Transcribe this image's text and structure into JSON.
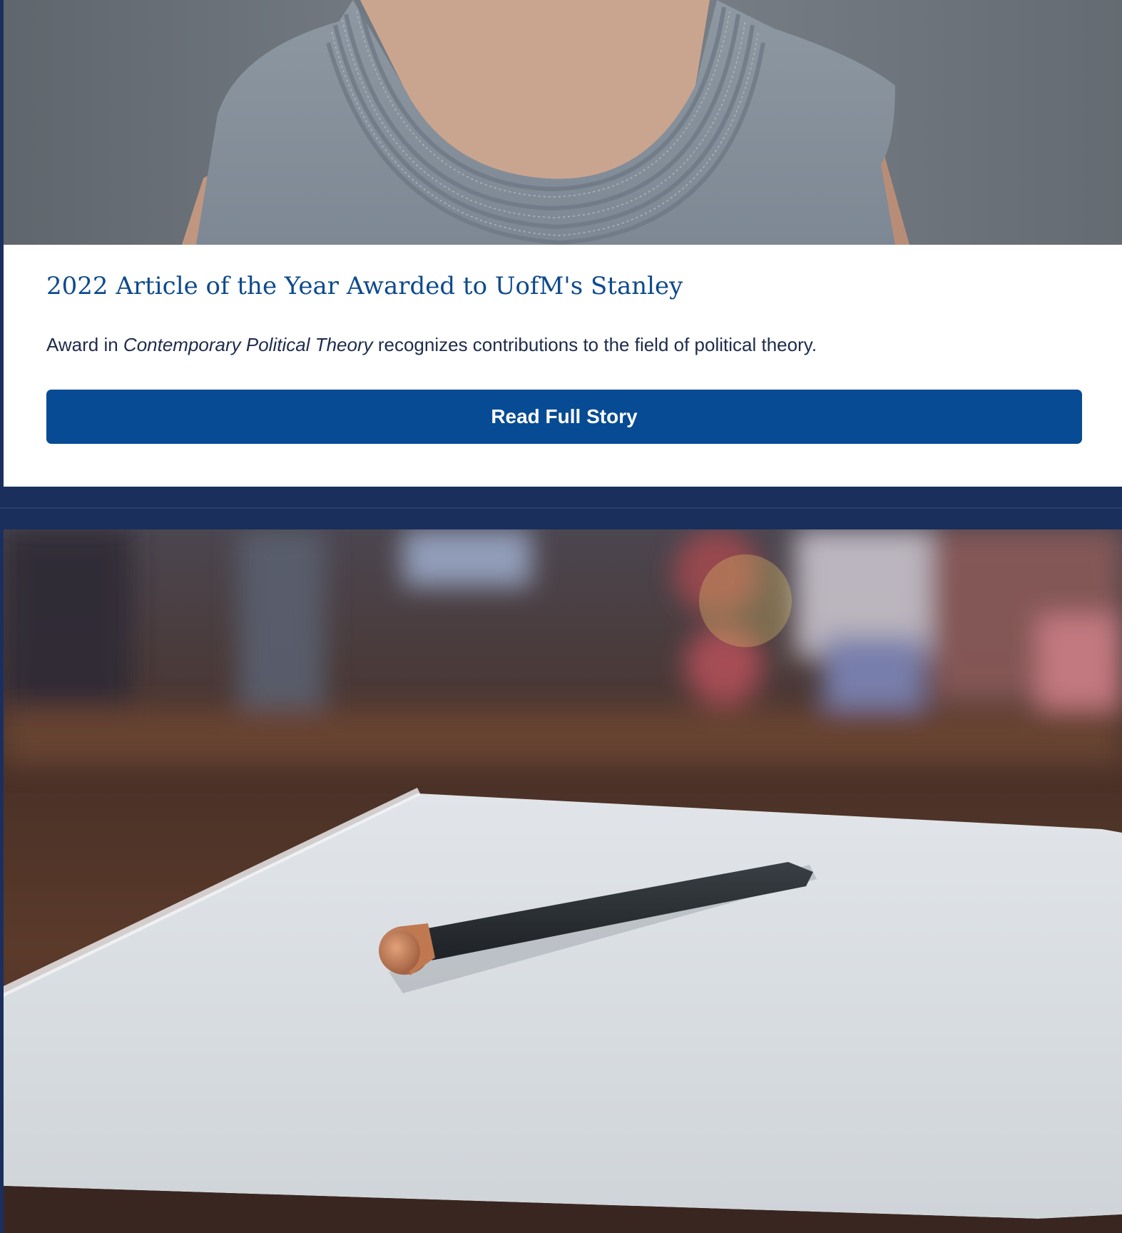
{
  "article": {
    "title": "2022 Article of the Year Awarded to UofM's Stanley",
    "description_prefix": "Award in ",
    "description_italic": "Contemporary Political Theory",
    "description_suffix": " recognizes contributions to the field of political theory.",
    "button_label": "Read Full Story"
  },
  "colors": {
    "title": "#0d4a8c",
    "button": "#064b93",
    "background": "#1a2f5c"
  }
}
